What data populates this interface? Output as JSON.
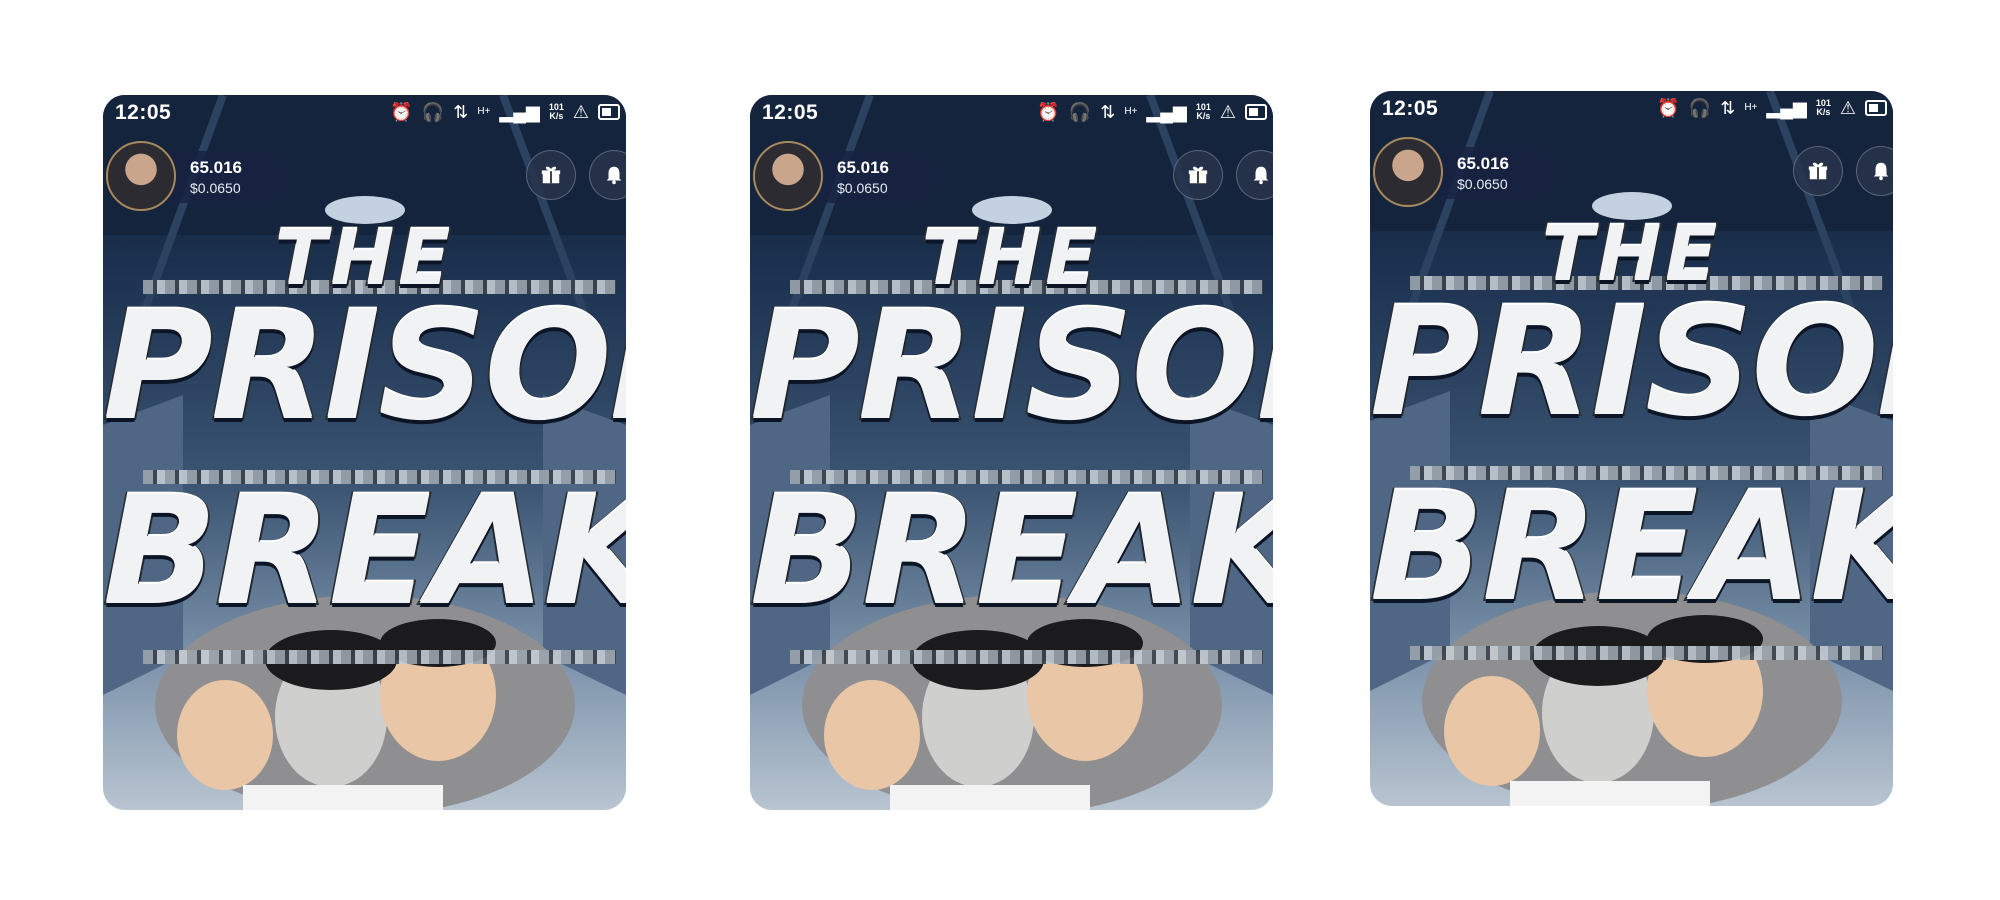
{
  "screens": [
    {
      "status": {
        "time": "12:05",
        "speed_top": "101",
        "speed_bottom": "K/s",
        "network": "H+"
      },
      "profile": {
        "balance": "65.016",
        "usd": "$0.0650"
      },
      "title": {
        "line1": "THE",
        "line2": "PRISON",
        "line3": "BREAK"
      },
      "icons": [
        "alarm-icon",
        "headphones-icon",
        "data-arrows-icon",
        "signal-icon",
        "warning-icon",
        "battery-icon",
        "gift-icon",
        "bell-icon"
      ]
    },
    {
      "status": {
        "time": "12:05",
        "speed_top": "101",
        "speed_bottom": "K/s",
        "network": "H+"
      },
      "profile": {
        "balance": "65.016",
        "usd": "$0.0650"
      },
      "title": {
        "line1": "THE",
        "line2": "PRISON",
        "line3": "BREAK"
      },
      "icons": [
        "alarm-icon",
        "headphones-icon",
        "data-arrows-icon",
        "signal-icon",
        "warning-icon",
        "battery-icon",
        "gift-icon",
        "bell-icon"
      ]
    },
    {
      "status": {
        "time": "12:05",
        "speed_top": "101",
        "speed_bottom": "K/s",
        "network": "H+"
      },
      "profile": {
        "balance": "65.016",
        "usd": "$0.0650"
      },
      "title": {
        "line1": "THE",
        "line2": "PRISON",
        "line3": "BREAK"
      },
      "icons": [
        "alarm-icon",
        "headphones-icon",
        "data-arrows-icon",
        "signal-icon",
        "warning-icon",
        "battery-icon",
        "gift-icon",
        "bell-icon"
      ]
    }
  ],
  "colors": {
    "accent_pill": "#172242",
    "title_fill": "#f0f2f4",
    "background_top": "#0f1d33"
  }
}
